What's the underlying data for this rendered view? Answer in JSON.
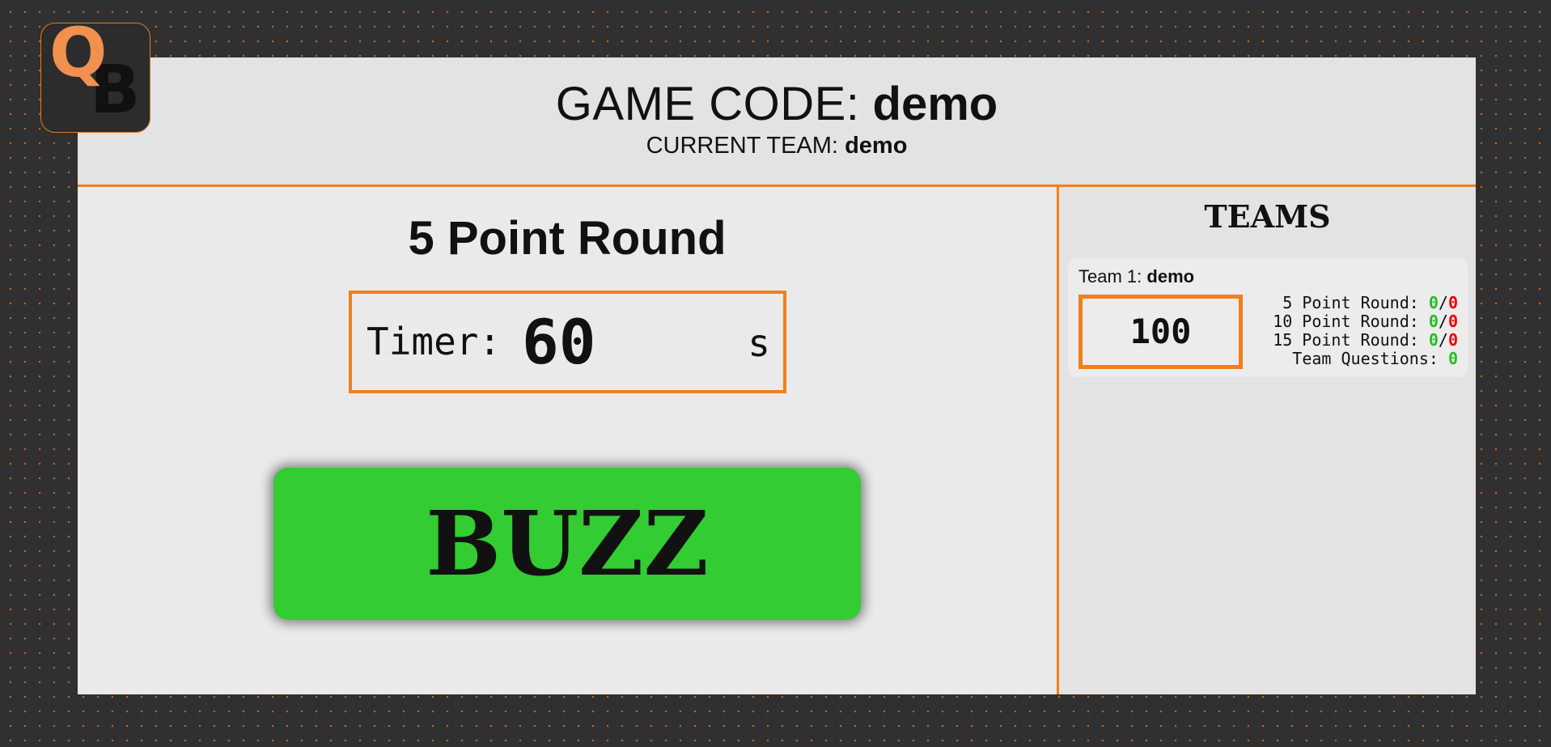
{
  "logo": {
    "letter_1": "Q",
    "letter_2": "B",
    "accent": "#f2904f"
  },
  "header": {
    "game_code_label": "GAME CODE:",
    "game_code": "demo",
    "current_team_label": "CURRENT TEAM:",
    "current_team": "demo"
  },
  "round": {
    "title": "5 Point Round"
  },
  "timer": {
    "label": "Timer:",
    "value": "60",
    "unit": "s"
  },
  "buzz": {
    "label": "BUZZ",
    "color": "#33cc33"
  },
  "teams": {
    "title": "TEAMS",
    "list": [
      {
        "prefix": "Team 1:",
        "name": "demo",
        "score": "100",
        "stats": [
          {
            "label": "5 Point Round:",
            "correct": "0",
            "sep": "/",
            "wrong": "0"
          },
          {
            "label": "10 Point Round:",
            "correct": "0",
            "sep": "/",
            "wrong": "0"
          },
          {
            "label": "15 Point Round:",
            "correct": "0",
            "sep": "/",
            "wrong": "0"
          }
        ],
        "team_questions": {
          "label": "Team Questions:",
          "value": "0"
        }
      }
    ]
  },
  "colors": {
    "accent": "#f07f1c",
    "correct": "#22c022",
    "wrong": "#ee0000",
    "background": "#303030"
  }
}
